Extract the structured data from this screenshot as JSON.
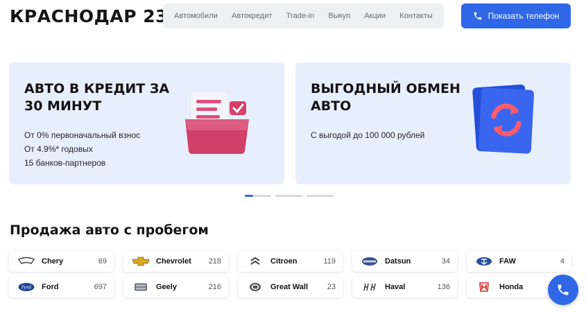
{
  "header": {
    "logo": "КРАСНОДАР 23",
    "nav": [
      "Автомобили",
      "Автокредит",
      "Trade-in",
      "Выкуп",
      "Акции",
      "Контакты"
    ],
    "phone_button": "Показать телефон"
  },
  "banners": [
    {
      "title": "АВТО В КРЕДИТ ЗА 30 МИНУТ",
      "lines": [
        "От 0% первоначальный взнос",
        "От 4.9%* годовых",
        "15 банков-партнеров"
      ],
      "icon": "credit-document-icon"
    },
    {
      "title": "ВЫГОДНЫЙ ОБМЕН АВТО",
      "lines": [
        "С выгодой до 100 000 рублей"
      ],
      "icon": "exchange-arrows-icon"
    }
  ],
  "slider": {
    "count": 3,
    "active": 1
  },
  "section_title": "Продажа авто с пробегом",
  "brands": [
    {
      "name": "Chery",
      "count": "69",
      "icon": "chery-logo-icon"
    },
    {
      "name": "Chevrolet",
      "count": "218",
      "icon": "chevrolet-logo-icon"
    },
    {
      "name": "Citroen",
      "count": "119",
      "icon": "citroen-logo-icon"
    },
    {
      "name": "Datsun",
      "count": "34",
      "icon": "datsun-logo-icon"
    },
    {
      "name": "FAW",
      "count": "4",
      "icon": "faw-logo-icon"
    },
    {
      "name": "Ford",
      "count": "697",
      "icon": "ford-logo-icon"
    },
    {
      "name": "Geely",
      "count": "216",
      "icon": "geely-logo-icon"
    },
    {
      "name": "Great Wall",
      "count": "23",
      "icon": "great-wall-logo-icon"
    },
    {
      "name": "Haval",
      "count": "136",
      "icon": "haval-logo-icon"
    },
    {
      "name": "Honda",
      "count": "",
      "icon": "honda-logo-icon"
    }
  ],
  "colors": {
    "accent": "#2f67e6",
    "banner_bg": "#e7efff",
    "nav_bg": "#eef0f3"
  }
}
